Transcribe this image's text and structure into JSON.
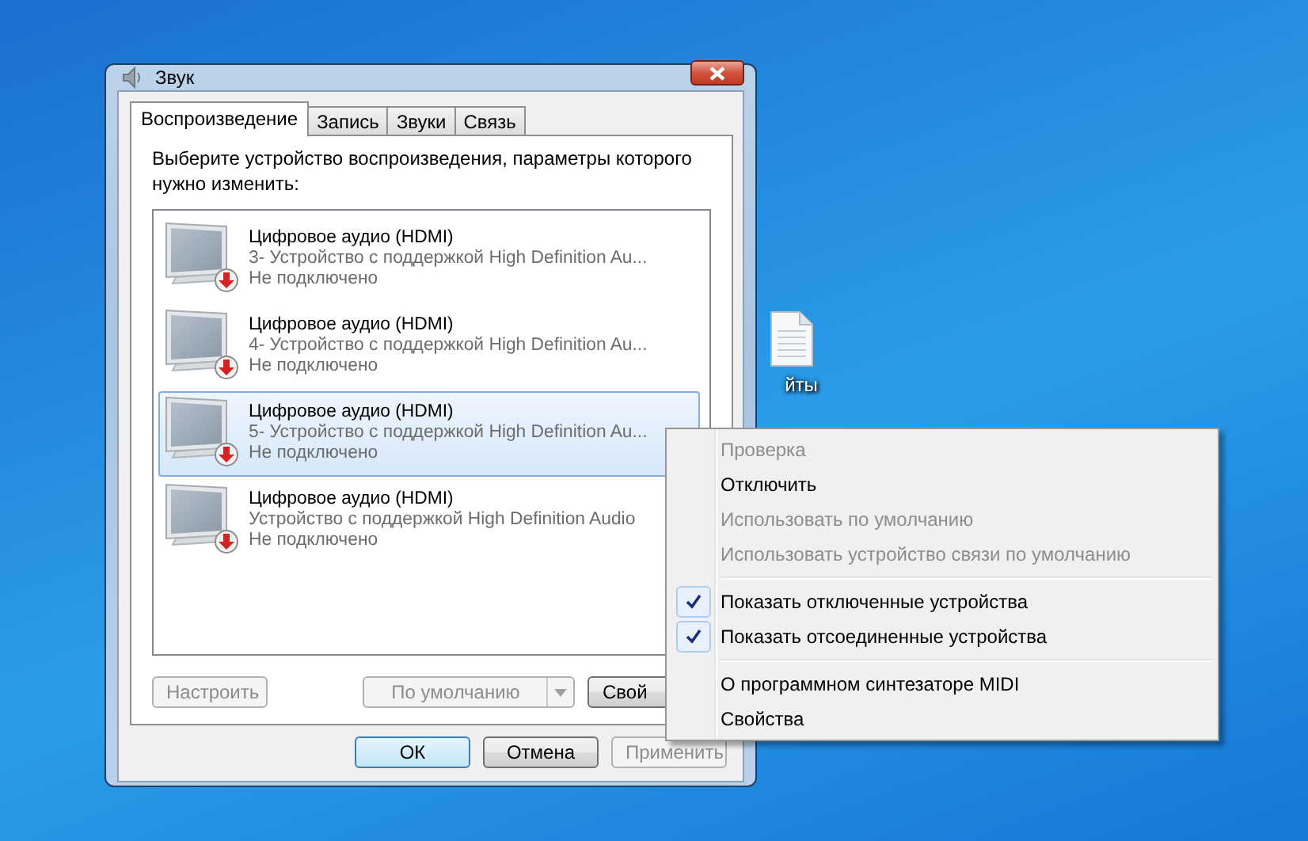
{
  "desktop": {
    "icon_label": "йты"
  },
  "window": {
    "title": "Звук"
  },
  "tabs": [
    {
      "label": "Воспроизведение",
      "selected": true
    },
    {
      "label": "Запись",
      "selected": false
    },
    {
      "label": "Звуки",
      "selected": false
    },
    {
      "label": "Связь",
      "selected": false
    }
  ],
  "instruction": "Выберите устройство воспроизведения, параметры которого нужно изменить:",
  "devices": [
    {
      "name": "Цифровое аудио (HDMI)",
      "description": "3- Устройство с поддержкой High Definition Au...",
      "status": "Не подключено",
      "selected": false
    },
    {
      "name": "Цифровое аудио (HDMI)",
      "description": "4- Устройство с поддержкой High Definition Au...",
      "status": "Не подключено",
      "selected": false
    },
    {
      "name": "Цифровое аудио (HDMI)",
      "description": "5- Устройство с поддержкой High Definition Au...",
      "status": "Не подключено",
      "selected": true
    },
    {
      "name": "Цифровое аудио (HDMI)",
      "description": "Устройство с поддержкой High Definition Audio",
      "status": "Не подключено",
      "selected": false
    }
  ],
  "panel_buttons": {
    "configure": {
      "label": "Настроить",
      "disabled": true
    },
    "default": {
      "label": "По умолчанию",
      "disabled": true
    },
    "properties": {
      "label": "Свой",
      "disabled": false
    }
  },
  "dialog_buttons": [
    {
      "label": "ОК",
      "disabled": false,
      "default": true
    },
    {
      "label": "Отмена",
      "disabled": false,
      "default": false
    },
    {
      "label": "Применить",
      "disabled": true,
      "default": false
    }
  ],
  "context_menu": [
    {
      "kind": "item",
      "label": "Проверка",
      "disabled": true,
      "checked": false
    },
    {
      "kind": "item",
      "label": "Отключить",
      "disabled": false,
      "checked": false
    },
    {
      "kind": "item",
      "label": "Использовать по умолчанию",
      "disabled": true,
      "checked": false
    },
    {
      "kind": "item",
      "label": "Использовать устройство связи по умолчанию",
      "disabled": true,
      "checked": false
    },
    {
      "kind": "separator"
    },
    {
      "kind": "item",
      "label": "Показать отключенные устройства",
      "disabled": false,
      "checked": true
    },
    {
      "kind": "item",
      "label": "Показать отсоединенные устройства",
      "disabled": false,
      "checked": true
    },
    {
      "kind": "separator"
    },
    {
      "kind": "item",
      "label": "О программном синтезаторе MIDI",
      "disabled": false,
      "checked": false
    },
    {
      "kind": "item",
      "label": "Свойства",
      "disabled": false,
      "checked": false
    }
  ]
}
